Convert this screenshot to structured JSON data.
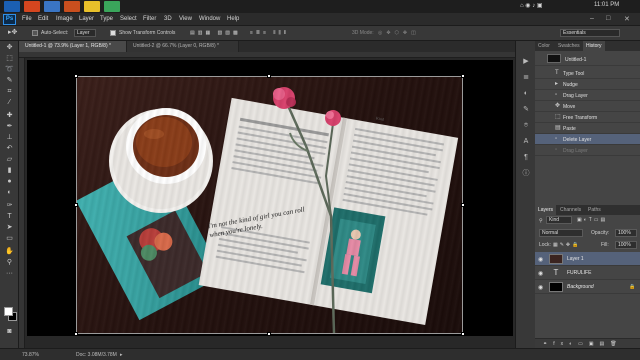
{
  "taskbar": {
    "apps": [
      {
        "name": "photoshop-app",
        "color": "#1b5fb3"
      },
      {
        "name": "files-app",
        "color": "#d4461f"
      },
      {
        "name": "docs-app",
        "color": "#3a75c4"
      },
      {
        "name": "media-app",
        "color": "#c94f1e"
      },
      {
        "name": "browser-app",
        "color": "#e8c02a"
      },
      {
        "name": "chrome-app",
        "color": "#3aa55b"
      }
    ],
    "clock": "11:01 PM"
  },
  "menubar": {
    "logo": "Ps",
    "items": [
      "File",
      "Edit",
      "Image",
      "Layer",
      "Type",
      "Select",
      "Filter",
      "3D",
      "View",
      "Window",
      "Help"
    ],
    "window_controls": [
      "–",
      "□",
      "✕"
    ]
  },
  "optionsbar": {
    "auto_select_label": "Auto-Select:",
    "auto_select_value": "Layer",
    "show_transform_label": "Show Transform Controls",
    "mode_3d_label": "3D Mode:",
    "workspace": "Essentials"
  },
  "doc_tabs": [
    {
      "label": "Untitled-1 @ 73.9% (Layer 1, RGB/8) *",
      "active": true
    },
    {
      "label": "Untitled-2 @ 66.7% (Layer 0, RGB/8) *",
      "active": false
    }
  ],
  "status": {
    "zoom": "73.87%",
    "doc": "Doc: 3.08M/3.78M"
  },
  "history_panel": {
    "tabs": [
      "Color",
      "Swatches",
      "History"
    ],
    "active_tab": "History",
    "snapshot": "Untitled-1",
    "items": [
      {
        "label": "Type Tool",
        "state": "normal"
      },
      {
        "label": "Nudge",
        "state": "normal"
      },
      {
        "label": "Drag Layer",
        "state": "normal"
      },
      {
        "label": "Move",
        "state": "normal"
      },
      {
        "label": "Free Transform",
        "state": "normal"
      },
      {
        "label": "Paste",
        "state": "normal"
      },
      {
        "label": "Delete Layer",
        "state": "active"
      },
      {
        "label": "Drag Layer",
        "state": "dim"
      }
    ]
  },
  "layers_panel": {
    "tabs": [
      "Layers",
      "Channels",
      "Paths"
    ],
    "active_tab": "Layers",
    "kind_label": "Kind",
    "blend_mode": "Normal",
    "opacity_label": "Opacity:",
    "opacity_value": "100%",
    "lock_label": "Lock:",
    "fill_label": "Fill:",
    "fill_value": "100%",
    "layers": [
      {
        "name": "Layer 1",
        "type": "image",
        "active": true
      },
      {
        "name": "FURULIFE",
        "type": "text",
        "active": false
      },
      {
        "name": "Background",
        "type": "background",
        "active": false
      }
    ]
  },
  "photo": {
    "quote": "I'm not the kind of girl you can roll when you're lonely.",
    "tag": "Kind"
  },
  "colors": {
    "accent_blue": "#55627a",
    "ps_blue": "#38a8ff",
    "foreground_swatch": "#ffffff",
    "background_swatch": "#000000"
  }
}
